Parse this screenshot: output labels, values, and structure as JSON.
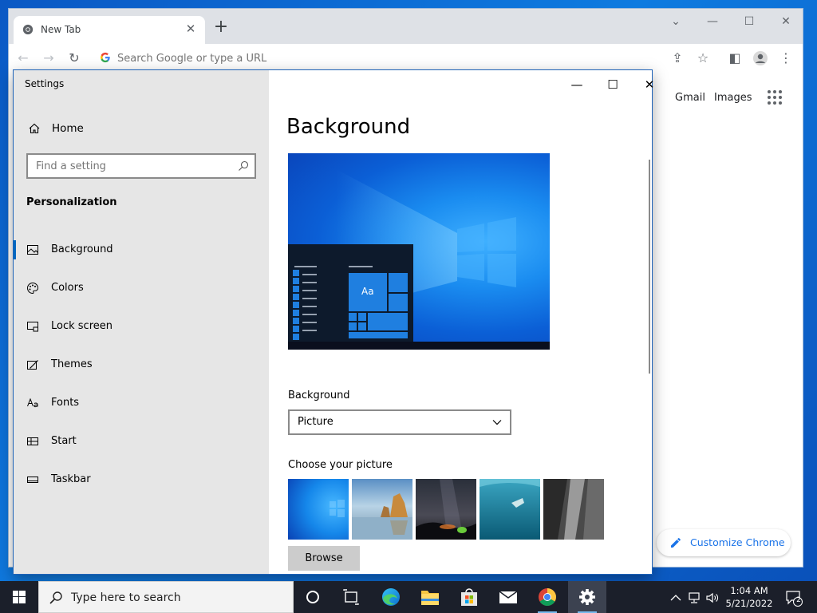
{
  "chrome": {
    "tab_title": "New Tab",
    "tab_close": "✕",
    "new_tab": "+",
    "omnibox_placeholder": "Search Google or type a URL",
    "links": {
      "gmail": "Gmail",
      "images": "Images"
    },
    "customize_label": "Customize Chrome"
  },
  "settings": {
    "window_title": "Settings",
    "home_label": "Home",
    "search_placeholder": "Find a setting",
    "section_label": "Personalization",
    "nav": [
      {
        "label": "Background",
        "icon": "image-icon",
        "active": true
      },
      {
        "label": "Colors",
        "icon": "palette-icon"
      },
      {
        "label": "Lock screen",
        "icon": "lock-screen-icon"
      },
      {
        "label": "Themes",
        "icon": "themes-icon"
      },
      {
        "label": "Fonts",
        "icon": "fonts-icon"
      },
      {
        "label": "Start",
        "icon": "start-icon"
      },
      {
        "label": "Taskbar",
        "icon": "taskbar-icon"
      }
    ],
    "main": {
      "heading": "Background",
      "preview_sample_text": "Aa",
      "background_label": "Background",
      "background_value": "Picture",
      "choose_label": "Choose your picture",
      "browse_label": "Browse"
    }
  },
  "taskbar": {
    "search_text": "Type here to search",
    "time": "1:04 AM",
    "date": "5/21/2022",
    "notification_count": "2"
  },
  "colors": {
    "accent": "#0067c0",
    "chrome_link": "#1a73e8",
    "taskbar": "#1b1f2a"
  }
}
